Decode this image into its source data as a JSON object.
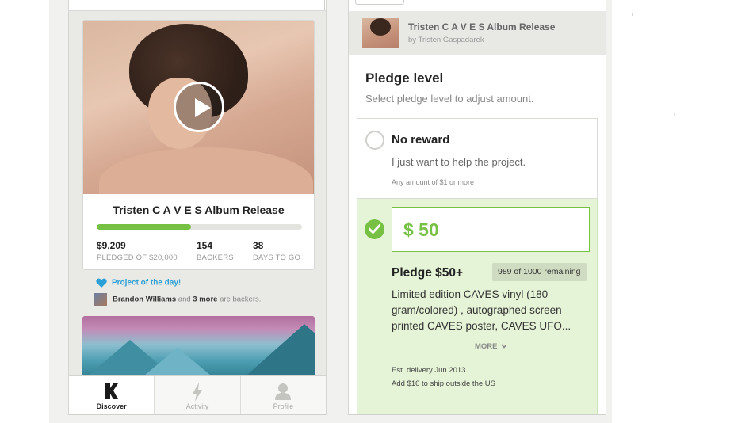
{
  "discover_screen": {
    "project_card": {
      "title": "Tristen C A V E S Album Release",
      "funded_fraction": 0.46,
      "stats": [
        {
          "value": "$9,209",
          "label": "PLEDGED OF $20,000"
        },
        {
          "value": "154",
          "label": "BACKERS"
        },
        {
          "value": "38",
          "label": "DAYS TO GO"
        }
      ]
    },
    "project_of_day": "Project of the day!",
    "backers_note": {
      "name": "Brandon Williams",
      "mid": " and ",
      "count": "3 more",
      "tail": " are backers."
    },
    "tabs": [
      {
        "label": "Discover",
        "icon": "kickstarter-k-icon",
        "active": true
      },
      {
        "label": "Activity",
        "icon": "lightning-icon",
        "active": false
      },
      {
        "label": "Profile",
        "icon": "person-icon",
        "active": false
      }
    ]
  },
  "pledge_screen": {
    "header": {
      "title": "Tristen C A V E S Album Release",
      "byline": "by Tristen Gaspadarek"
    },
    "heading": "Pledge level",
    "subheading": "Select pledge level to adjust amount.",
    "option_none": {
      "title": "No reward",
      "desc": "I just want to help the project.",
      "note": "Any amount of $1 or more"
    },
    "option_selected": {
      "amount": "$ 50",
      "title": "Pledge $50+",
      "remaining": "989 of 1000 remaining",
      "desc": "Limited edition CAVES vinyl (180 gram/colored) , autographed screen printed CAVES poster, CAVES UFO...",
      "more": "MORE",
      "delivery": "Est. delivery Jun 2013",
      "shipping": "Add $10 to ship outside the US"
    }
  },
  "colors": {
    "accent_green": "#76c043",
    "link_blue": "#2aa0d6",
    "selected_bg": "#e5f3d6"
  }
}
